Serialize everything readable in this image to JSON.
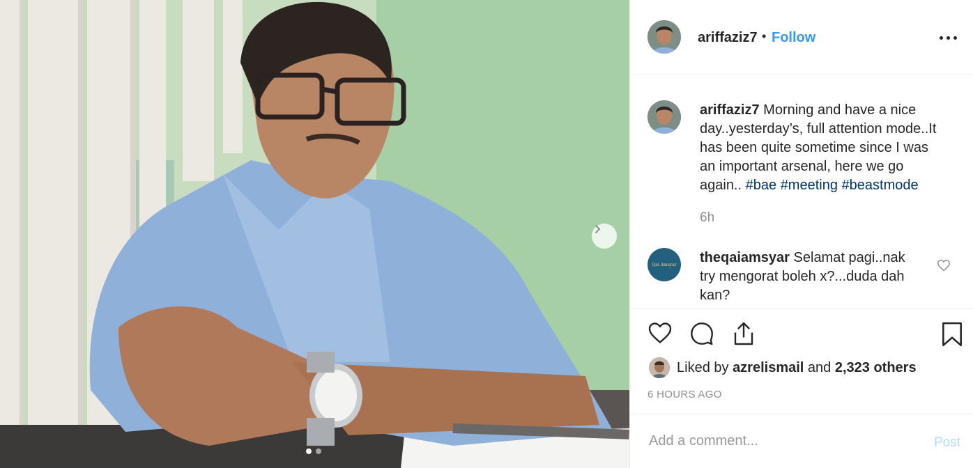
{
  "post": {
    "photo_alt": "",
    "page_count": 2,
    "current_page": 1
  },
  "header": {
    "username": "ariffaziz7",
    "separator": "•",
    "follow_label": "Follow"
  },
  "caption": {
    "username": "ariffaziz7",
    "text": "Morning and have a nice day..yesterday’s, full attention mode..It has been quite sometime since I was an important arsenal, here we go again..",
    "hashtags": [
      "#bae",
      "#meeting",
      "#beastmode"
    ],
    "time": "6h"
  },
  "comments": [
    {
      "username": "theqaiamsyar",
      "avatar_text": "Qai Amsyar",
      "text": "Selamat pagi..nak try mengorat boleh x?...duda dah kan?"
    }
  ],
  "likes": {
    "prefix": "Liked by",
    "user": "azrelismail",
    "conj": "and",
    "others": "2,323 others"
  },
  "timestamp": "6 HOURS AGO",
  "add_comment": {
    "placeholder": "Add a comment...",
    "post_label": "Post"
  },
  "icons": {
    "like": "heart-icon",
    "comment": "comment-bubble-icon",
    "share": "share-icon",
    "save": "bookmark-icon",
    "next": "chevron-right-icon",
    "more": "more-dots-icon"
  },
  "colors": {
    "accent": "#3897f0",
    "hashtag": "#003569",
    "muted": "#8e8e8e",
    "post_disabled": "#b3dbff"
  }
}
